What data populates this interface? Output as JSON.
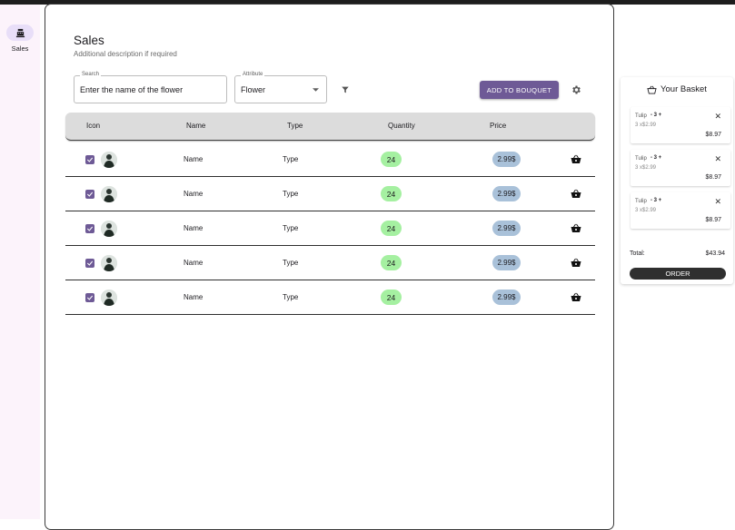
{
  "nav": {
    "items": [
      {
        "label": "Sales",
        "icon": "cash-register-icon",
        "active": true
      }
    ]
  },
  "page": {
    "title": "Sales",
    "subtitle": "Additional description if required"
  },
  "search": {
    "label": "Search",
    "value": "Enter the name of the flower"
  },
  "attribute": {
    "label": "Attribute",
    "value": "Flower"
  },
  "toolbar": {
    "add_label": "ADD TO BOUQUET",
    "filter_icon": "filter-icon",
    "settings_icon": "gear-icon"
  },
  "table": {
    "headers": [
      "Icon",
      "Name",
      "Type",
      "Quantity",
      "Price"
    ],
    "rows": [
      {
        "checked": true,
        "name": "Name",
        "type": "Type",
        "quantity": "24",
        "price": "2.99$"
      },
      {
        "checked": true,
        "name": "Name",
        "type": "Type",
        "quantity": "24",
        "price": "2.99$"
      },
      {
        "checked": true,
        "name": "Name",
        "type": "Type",
        "quantity": "24",
        "price": "2.99$"
      },
      {
        "checked": true,
        "name": "Name",
        "type": "Type",
        "quantity": "24",
        "price": "2.99$"
      },
      {
        "checked": true,
        "name": "Name",
        "type": "Type",
        "quantity": "24",
        "price": "2.99$"
      }
    ]
  },
  "basket": {
    "title": "Your Basket",
    "items": [
      {
        "name": "Tulip",
        "stepper": "- 3 +",
        "sub": "3 x$2.99",
        "total": "$8.97"
      },
      {
        "name": "Tulip",
        "stepper": "- 3 +",
        "sub": "3 x$2.99",
        "total": "$8.97"
      },
      {
        "name": "Tulip",
        "stepper": "- 3 +",
        "sub": "3 x$2.99",
        "total": "$8.97"
      }
    ],
    "total_label": "Total:",
    "total_value": "$43.94",
    "order_label": "ORDER"
  },
  "colors": {
    "primary": "#6e5a96",
    "rail_bg": "#fcf3fb",
    "rail_active": "#e8def8",
    "quantity_badge": "#a5f0a1",
    "price_badge": "#a9c1d9",
    "order_button": "#2f2f2f"
  }
}
